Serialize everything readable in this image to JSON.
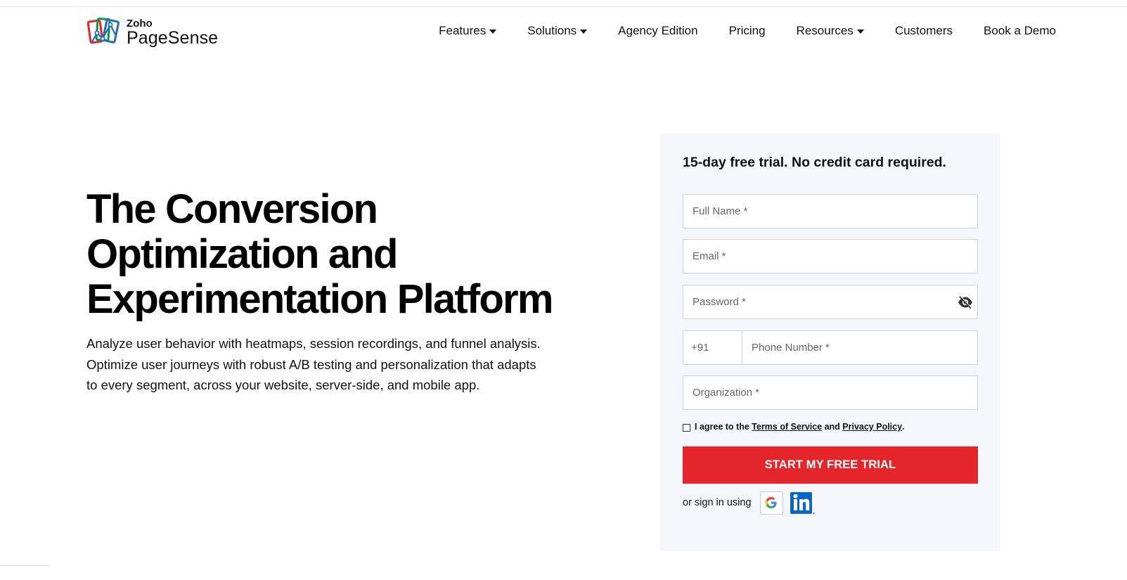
{
  "brand": {
    "company": "Zoho",
    "product": "PageSense",
    "logo_icon": "pagesense-logo-icon"
  },
  "nav": {
    "items": [
      {
        "label": "Features",
        "dropdown": true
      },
      {
        "label": "Solutions",
        "dropdown": true
      },
      {
        "label": "Agency Edition",
        "dropdown": false
      },
      {
        "label": "Pricing",
        "dropdown": false
      },
      {
        "label": "Resources",
        "dropdown": true
      },
      {
        "label": "Customers",
        "dropdown": false
      },
      {
        "label": "Book a Demo",
        "dropdown": false
      }
    ]
  },
  "hero": {
    "title_lines": [
      "The Conversion",
      "Optimization and",
      "Experimentation Platform"
    ],
    "description_lines": [
      "Analyze user behavior with heatmaps, session recordings, and funnel analysis.",
      "Optimize user journeys with robust A/B testing and personalization that adapts",
      "to every segment, across your website, server-side, and mobile app."
    ]
  },
  "signup_form": {
    "title": "15-day free trial. No credit card required.",
    "fields": {
      "full_name_placeholder": "Full Name *",
      "email_placeholder": "Email *",
      "password_placeholder": "Password *",
      "country_code": "+91",
      "phone_placeholder": "Phone Number *",
      "organization_placeholder": "Organization *"
    },
    "agreement": {
      "prefix": "I agree to the ",
      "terms_link": "Terms of Service",
      "middle": " and ",
      "privacy_link": "Privacy Policy",
      "suffix": ".",
      "checked": false
    },
    "submit_label": "START MY FREE TRIAL",
    "social_signin": {
      "label": "or sign in using",
      "providers": [
        "google-icon",
        "linkedin-icon"
      ]
    }
  },
  "colors": {
    "cta_red": "#e4262b",
    "panel_bg": "#f6f7fd",
    "linkedin_blue": "#0a66c2"
  }
}
